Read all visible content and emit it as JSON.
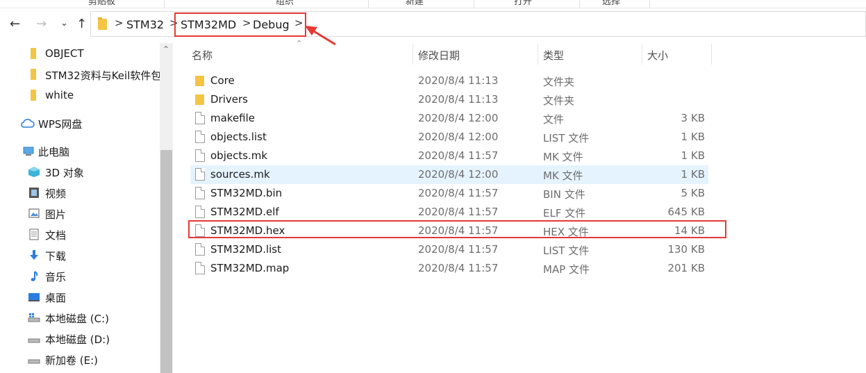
{
  "ribbon": {
    "groups": [
      "剪贴板",
      "组织",
      "新建",
      "打开",
      "选择"
    ]
  },
  "nav": {
    "back_icon": "arrow-left-icon",
    "forward_icon": "arrow-right-icon",
    "recent_icon": "chevron-down-icon",
    "up_icon": "arrow-up-icon"
  },
  "address": {
    "segments": [
      "STM32",
      "STM32MD",
      "Debug"
    ],
    "separator": ">"
  },
  "sidebar": {
    "items": [
      {
        "label": "OBJECT",
        "icon": "folder-icon"
      },
      {
        "label": "STM32资料与Keil软件包",
        "icon": "folder-icon"
      },
      {
        "label": "white",
        "icon": "folder-icon"
      },
      {
        "label": "WPS网盘",
        "icon": "cloud-icon"
      },
      {
        "label": "此电脑",
        "icon": "computer-icon"
      },
      {
        "label": "3D 对象",
        "icon": "cube-icon"
      },
      {
        "label": "视频",
        "icon": "video-icon"
      },
      {
        "label": "图片",
        "icon": "picture-icon"
      },
      {
        "label": "文档",
        "icon": "document-icon"
      },
      {
        "label": "下载",
        "icon": "download-icon"
      },
      {
        "label": "音乐",
        "icon": "music-icon"
      },
      {
        "label": "桌面",
        "icon": "desktop-icon"
      },
      {
        "label": "本地磁盘 (C:)",
        "icon": "drive-icon"
      },
      {
        "label": "本地磁盘 (D:)",
        "icon": "drive-icon"
      },
      {
        "label": "新加卷 (E:)",
        "icon": "drive-icon"
      }
    ]
  },
  "columns": {
    "name": "名称",
    "date": "修改日期",
    "type": "类型",
    "size": "大小"
  },
  "files": [
    {
      "name": "Core",
      "date": "2020/8/4 11:13",
      "type": "文件夹",
      "size": "",
      "kind": "folder"
    },
    {
      "name": "Drivers",
      "date": "2020/8/4 11:13",
      "type": "文件夹",
      "size": "",
      "kind": "folder"
    },
    {
      "name": "makefile",
      "date": "2020/8/4 12:00",
      "type": "文件",
      "size": "3 KB",
      "kind": "file"
    },
    {
      "name": "objects.list",
      "date": "2020/8/4 12:00",
      "type": "LIST 文件",
      "size": "1 KB",
      "kind": "file"
    },
    {
      "name": "objects.mk",
      "date": "2020/8/4 11:57",
      "type": "MK 文件",
      "size": "1 KB",
      "kind": "file"
    },
    {
      "name": "sources.mk",
      "date": "2020/8/4 12:00",
      "type": "MK 文件",
      "size": "1 KB",
      "kind": "file",
      "hovered": true
    },
    {
      "name": "STM32MD.bin",
      "date": "2020/8/4 11:57",
      "type": "BIN 文件",
      "size": "5 KB",
      "kind": "file"
    },
    {
      "name": "STM32MD.elf",
      "date": "2020/8/4 11:57",
      "type": "ELF 文件",
      "size": "645 KB",
      "kind": "file"
    },
    {
      "name": "STM32MD.hex",
      "date": "2020/8/4 11:57",
      "type": "HEX 文件",
      "size": "14 KB",
      "kind": "file",
      "annotated": true
    },
    {
      "name": "STM32MD.list",
      "date": "2020/8/4 11:57",
      "type": "LIST 文件",
      "size": "130 KB",
      "kind": "file"
    },
    {
      "name": "STM32MD.map",
      "date": "2020/8/4 11:57",
      "type": "MAP 文件",
      "size": "201 KB",
      "kind": "file"
    }
  ],
  "colors": {
    "annotation_red": "#e53935",
    "hover_row": "#e5f3ff",
    "folder_yellow": "#f4c542"
  }
}
